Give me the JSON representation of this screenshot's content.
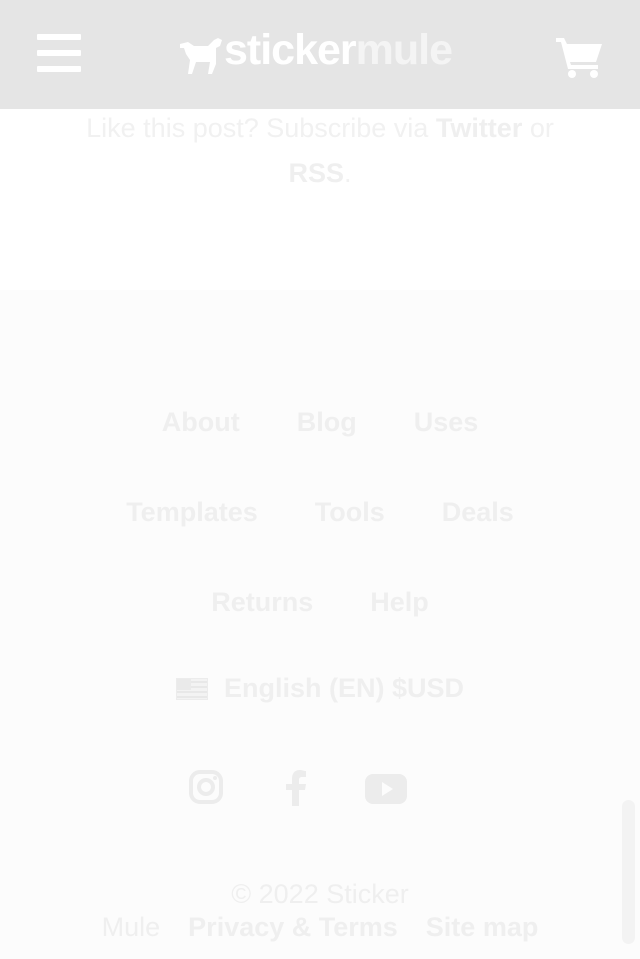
{
  "header": {
    "logo_part1": "sticker",
    "logo_part2": "mule"
  },
  "post_cta": {
    "text_before": "Like this post? Subscribe via ",
    "twitter": "Twitter",
    "text_or": " or ",
    "rss": "RSS",
    "text_end": "."
  },
  "footer": {
    "nav_rows": [
      [
        "About",
        "Blog",
        "Uses"
      ],
      [
        "Templates",
        "Tools",
        "Deals"
      ],
      [
        "Returns",
        "Help"
      ]
    ],
    "language": "English (EN) $USD",
    "social_icons": [
      "instagram-icon",
      "facebook-icon",
      "youtube-icon"
    ],
    "copyright": "© 2022 Sticker",
    "company_suffix": "Mule",
    "privacy": "Privacy & Terms",
    "sitemap": "Site map"
  }
}
